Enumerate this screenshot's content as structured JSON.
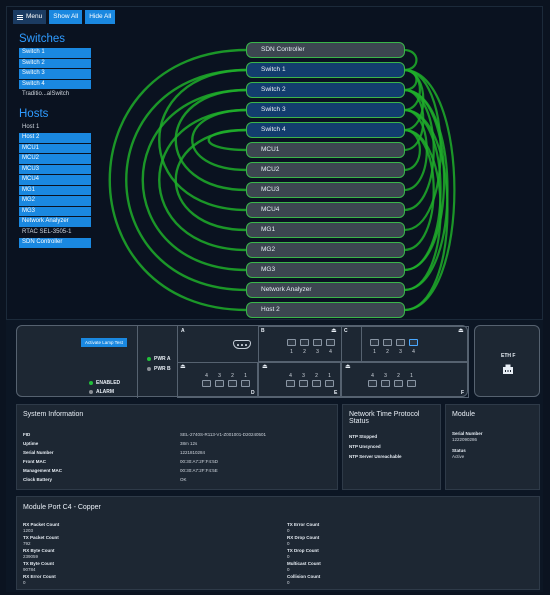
{
  "toolbar": {
    "menu_label": "Menu",
    "show_all_label": "Show All",
    "hide_all_label": "Hide All"
  },
  "sidebar": {
    "switches_header": "Switches",
    "switches": [
      "Switch 1",
      "Switch 2",
      "Switch 3",
      "Switch 4",
      "Traditio...alSwitch"
    ],
    "hosts_header": "Hosts",
    "hosts": [
      "Host 1",
      "Host 2",
      "MCU1",
      "MCU2",
      "MCU3",
      "MCU4",
      "MG1",
      "MG2",
      "MG3",
      "Network Analyzer",
      "RTAC SEL-3505-1",
      "SDN Controller"
    ]
  },
  "topology": {
    "nodes": [
      "SDN Controller",
      "Switch 1",
      "Switch 2",
      "Switch 3",
      "Switch 4",
      "MCU1",
      "MCU2",
      "MCU3",
      "MCU4",
      "MG1",
      "MG2",
      "MG3",
      "Network Analyzer",
      "Host 2"
    ],
    "link_color": "#1fae2a"
  },
  "device": {
    "lamp_button": "Activate Lamp Test",
    "pwr_a": "PWR A",
    "pwr_b": "PWR B",
    "enabled": "ENABLED",
    "alarm": "ALARM",
    "module_letters": [
      "A",
      "B",
      "C",
      "D",
      "E",
      "F"
    ],
    "ports_top": [
      "1",
      "2",
      "3",
      "4"
    ],
    "ports_bottom": [
      "4",
      "3",
      "2",
      "1"
    ],
    "eth_label": "ETH F",
    "led_colors": {
      "green": "#22c03a",
      "grey": "#8a8f96"
    }
  },
  "system_info": {
    "title": "System Information",
    "rows": [
      {
        "label": "FID",
        "value": "SEL-2740S-R113-V1-Z001001-D20240501"
      },
      {
        "label": "Uptime",
        "value": "38m 12s"
      },
      {
        "label": "Serial Number",
        "value": "1221810284"
      },
      {
        "label": "Front MAC",
        "value": "00:30:A7:2F:F4:5D"
      },
      {
        "label": "Management MAC",
        "value": "00:30:A7:2F:F4:5E"
      },
      {
        "label": "Clock Battery",
        "value": "OK"
      }
    ]
  },
  "ntp": {
    "title": "Network Time Protocol Status",
    "rows": [
      "NTP Stopped",
      "NTP Unsynced",
      "NTP Server Unreachable"
    ]
  },
  "module": {
    "title": "Module",
    "serial_label": "Serial Number",
    "serial_value": "1222090286",
    "status_label": "Status",
    "status_value": "Active"
  },
  "port_card": {
    "title": "Module Port C4 - Copper",
    "left": [
      {
        "label": "RX Packet Count",
        "value": "1203"
      },
      {
        "label": "TX Packet Count",
        "value": "792"
      },
      {
        "label": "RX Byte Count",
        "value": "239059"
      },
      {
        "label": "TX Byte Count",
        "value": "90784"
      },
      {
        "label": "RX Error Count",
        "value": "0"
      }
    ],
    "right": [
      {
        "label": "TX Error Count",
        "value": "0"
      },
      {
        "label": "RX Drop Count",
        "value": "0"
      },
      {
        "label": "TX Drop Count",
        "value": "0"
      },
      {
        "label": "Multicast Count",
        "value": "0"
      },
      {
        "label": "Collision Count",
        "value": "0"
      }
    ]
  }
}
